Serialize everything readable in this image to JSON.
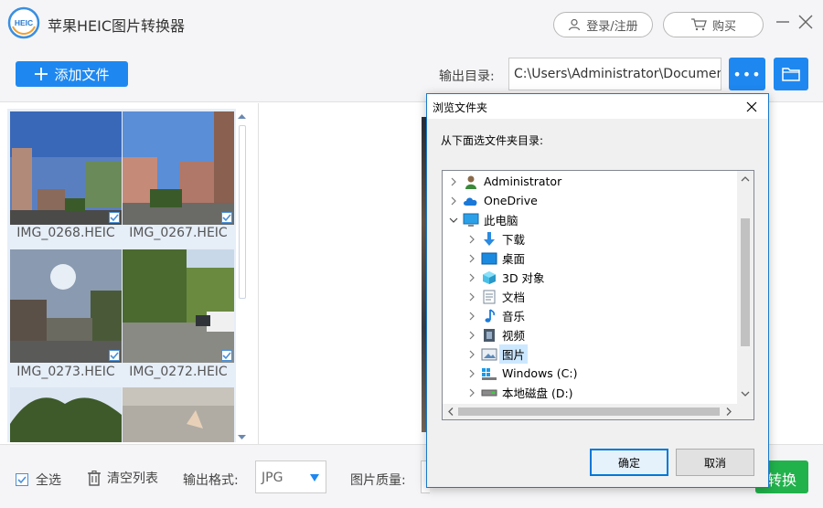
{
  "app": {
    "logo_text": "HEIC",
    "title": "苹果HEIC图片转换器",
    "login_label": "登录/注册",
    "buy_label": "购买"
  },
  "toolbar": {
    "add_files_label": "添加文件",
    "output_dir_label": "输出目录:",
    "output_dir_value": "C:\\Users\\Administrator\\Documents",
    "more_label": "•••"
  },
  "thumbnails": [
    {
      "name": "IMG_0268.HEIC",
      "checked": true
    },
    {
      "name": "IMG_0267.HEIC",
      "checked": true
    },
    {
      "name": "IMG_0273.HEIC",
      "checked": true
    },
    {
      "name": "IMG_0272.HEIC",
      "checked": true
    },
    {
      "name": "",
      "checked": false
    },
    {
      "name": "",
      "checked": false
    }
  ],
  "bottombar": {
    "select_all_label": "全选",
    "clear_list_label": "清空列表",
    "format_label": "输出格式:",
    "format_value": "JPG",
    "quality_label": "图片质量:",
    "convert_label": "转换"
  },
  "dialog": {
    "title": "浏览文件夹",
    "prompt": "从下面选文件夹目录:",
    "tree": [
      {
        "label": "Administrator",
        "icon": "user-folder-icon",
        "expanded": false,
        "selected": false
      },
      {
        "label": "OneDrive",
        "icon": "cloud-icon",
        "expanded": false,
        "selected": false
      },
      {
        "label": "此电脑",
        "icon": "computer-icon",
        "expanded": true,
        "selected": false
      },
      {
        "label": "下载",
        "icon": "download-icon",
        "expanded": false,
        "selected": false
      },
      {
        "label": "桌面",
        "icon": "desktop-icon",
        "expanded": false,
        "selected": false
      },
      {
        "label": "3D 对象",
        "icon": "3d-objects-icon",
        "expanded": false,
        "selected": false
      },
      {
        "label": "文档",
        "icon": "document-icon",
        "expanded": false,
        "selected": false
      },
      {
        "label": "音乐",
        "icon": "music-icon",
        "expanded": false,
        "selected": false
      },
      {
        "label": "视频",
        "icon": "video-icon",
        "expanded": false,
        "selected": false
      },
      {
        "label": "图片",
        "icon": "pictures-icon",
        "expanded": false,
        "selected": true
      },
      {
        "label": "Windows (C:)",
        "icon": "windows-drive-icon",
        "expanded": false,
        "selected": false
      },
      {
        "label": "本地磁盘 (D:)",
        "icon": "hard-drive-icon",
        "expanded": false,
        "selected": false
      }
    ],
    "ok_label": "确定",
    "cancel_label": "取消"
  },
  "colors": {
    "accent": "#1e88f0",
    "convert_green": "#21b24c",
    "dialog_border": "#1979ca",
    "selection": "#cce8ff"
  }
}
